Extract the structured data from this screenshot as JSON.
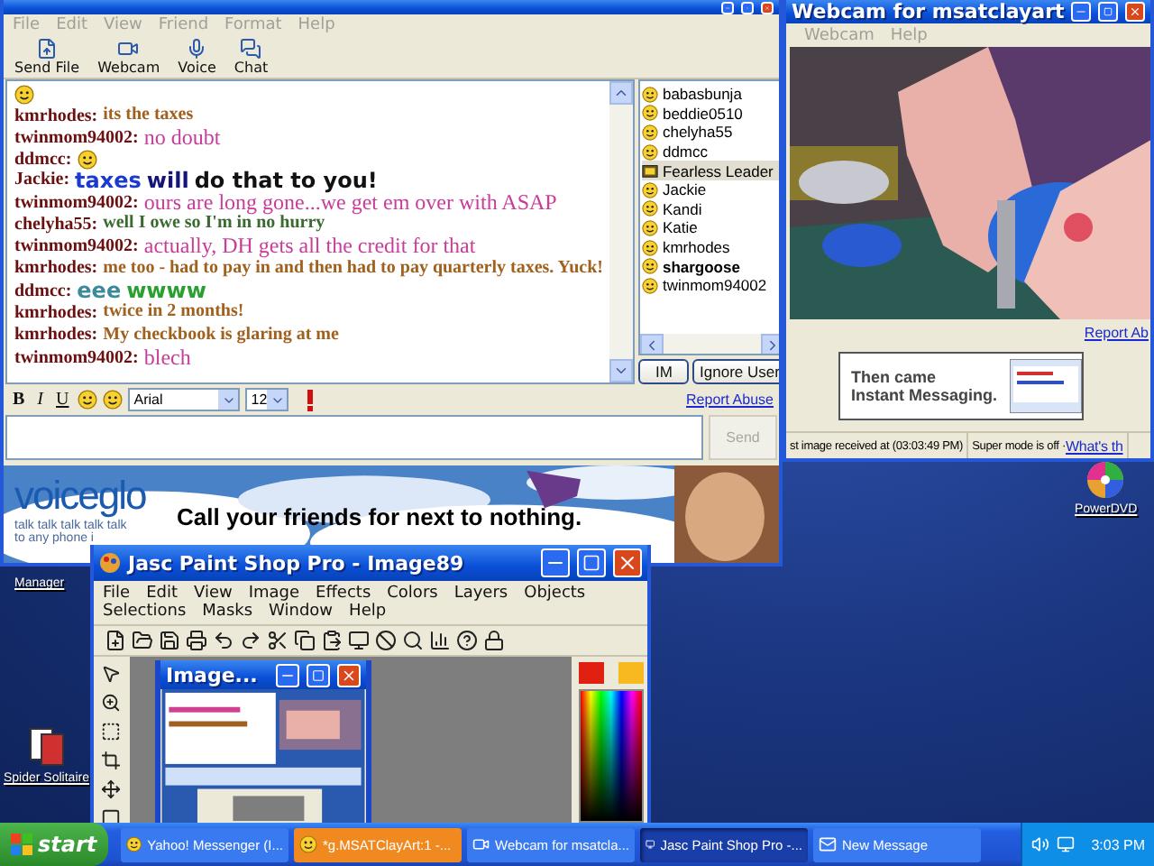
{
  "chat_window": {
    "menu": [
      "File",
      "Edit",
      "View",
      "Friend",
      "Format",
      "Help"
    ],
    "toolbar": [
      {
        "label": "Send File",
        "kind": "send-file"
      },
      {
        "label": "Webcam",
        "kind": "webcam"
      },
      {
        "label": "Voice",
        "kind": "voice"
      },
      {
        "label": "Chat",
        "kind": "chat"
      }
    ],
    "messages": [
      {
        "kind": "emoticon"
      },
      {
        "kind": "bold",
        "sender": "kmrhodes:",
        "parts": [
          {
            "text": "its the taxes",
            "color": "#a0601e"
          }
        ]
      },
      {
        "kind": "serif",
        "sender": "twinmom94002:",
        "parts": [
          {
            "text": "no doubt",
            "color": "#c83c9a"
          }
        ]
      },
      {
        "kind": "emoticon",
        "sender": "ddmcc:"
      },
      {
        "kind": "comic",
        "sender": "Jackie:",
        "parts": [
          {
            "text": "taxes",
            "color": "#1a3ad0"
          },
          {
            "text": "will",
            "color": "#14147a"
          },
          {
            "text": "do that to you!",
            "color": "#111111"
          }
        ]
      },
      {
        "kind": "serif",
        "sender": "twinmom94002:",
        "parts": [
          {
            "text": "ours are long gone...we get em over with ASAP",
            "color": "#c83c9a"
          }
        ]
      },
      {
        "kind": "bold",
        "sender": "chelyha55:",
        "parts": [
          {
            "text": "well I owe so I'm in no hurry",
            "color": "#3a6a30"
          }
        ]
      },
      {
        "kind": "serif",
        "sender": "twinmom94002:",
        "parts": [
          {
            "text": "actually, DH gets all the credit for that",
            "color": "#c83c9a"
          }
        ]
      },
      {
        "kind": "bold",
        "sender": "kmrhodes:",
        "parts": [
          {
            "text": "me too - had to pay in and then had to pay quarterly taxes. Yuck!",
            "color": "#a0601e"
          }
        ]
      },
      {
        "kind": "comic",
        "sender": "ddmcc:",
        "parts": [
          {
            "text": "eee",
            "color": "#3a8a9a"
          },
          {
            "text": "wwww",
            "color": "#2aa030"
          }
        ]
      },
      {
        "kind": "bold",
        "sender": "kmrhodes:",
        "parts": [
          {
            "text": "twice in 2 months!",
            "color": "#a0601e"
          }
        ]
      },
      {
        "kind": "bold",
        "sender": "kmrhodes:",
        "parts": [
          {
            "text": "My checkbook is glaring at me",
            "color": "#a0601e"
          }
        ]
      },
      {
        "kind": "serif",
        "sender": "twinmom94002:",
        "parts": [
          {
            "text": "blech",
            "color": "#c83c9a"
          }
        ]
      }
    ],
    "users": [
      {
        "name": "babasbunja",
        "kind": "smiley",
        "selected": false,
        "bold": false
      },
      {
        "name": "beddie0510",
        "kind": "smiley",
        "selected": false,
        "bold": false
      },
      {
        "name": "chelyha55",
        "kind": "smiley",
        "selected": false,
        "bold": false
      },
      {
        "name": "ddmcc",
        "kind": "smiley",
        "selected": false,
        "bold": false
      },
      {
        "name": "Fearless Leader",
        "kind": "webcam",
        "selected": true,
        "bold": false
      },
      {
        "name": "Jackie",
        "kind": "smiley",
        "selected": false,
        "bold": false
      },
      {
        "name": "Kandi",
        "kind": "smiley",
        "selected": false,
        "bold": false
      },
      {
        "name": "Katie",
        "kind": "smiley",
        "selected": false,
        "bold": false
      },
      {
        "name": "kmrhodes",
        "kind": "smiley",
        "selected": false,
        "bold": false
      },
      {
        "name": "shargoose",
        "kind": "smiley",
        "selected": false,
        "bold": true
      },
      {
        "name": "twinmom94002",
        "kind": "smiley",
        "selected": false,
        "bold": false
      }
    ],
    "user_buttons": [
      "IM",
      "Ignore User"
    ],
    "format_buttons": [
      {
        "label": "B",
        "kind": "bold"
      },
      {
        "label": "I",
        "kind": "italic"
      },
      {
        "label": "U",
        "kind": "underline"
      }
    ],
    "font": "Arial",
    "size": "12",
    "report": "Report Abuse",
    "send": "Send",
    "ad": {
      "logo": "voiceglo",
      "tagline": "talk talk talk talk talk",
      "tagline2": "to any phone i",
      "headline": "Call your friends for next to nothing."
    }
  },
  "webcam_window": {
    "title": "Webcam for msatclayart",
    "menu": [
      "Webcam",
      "Help"
    ],
    "report": "Report Ab",
    "ad": [
      "Then came",
      "Instant Messaging."
    ],
    "status": "st image received at (03:03:49 PM)",
    "super": "Super mode is off · ",
    "link": "What's th"
  },
  "paint_window": {
    "title": "Jasc Paint Shop Pro - Image89",
    "menu": [
      "File",
      "Edit",
      "View",
      "Image",
      "Effects",
      "Colors",
      "Layers",
      "Objects",
      "Selections",
      "Masks",
      "Window",
      "Help"
    ],
    "inner_title": "Image...",
    "swatches": [
      {
        "color": "#e02010"
      },
      {
        "color": "#f8b820"
      }
    ]
  },
  "desktop_icons": [
    {
      "label": "Manager",
      "kind": "manager"
    },
    {
      "label": "Spider Solitaire",
      "kind": "cards"
    },
    {
      "label": "PowerDVD",
      "kind": "disc"
    }
  ],
  "taskbar": {
    "start": "start",
    "tasks": [
      {
        "label": "Yahoo! Messenger (I...",
        "kind": "messenger",
        "selected": false,
        "flashing": false
      },
      {
        "label": "*g.MSATClayArt:1 -...",
        "kind": "chat",
        "selected": false,
        "flashing": true
      },
      {
        "label": "Webcam for msatcla...",
        "kind": "webcam",
        "selected": false,
        "flashing": false
      },
      {
        "label": "Jasc Paint Shop Pro -...",
        "kind": "paint",
        "selected": true,
        "flashing": false
      },
      {
        "label": "New Message",
        "kind": "mail",
        "selected": false,
        "flashing": false
      }
    ],
    "clock": "3:03 PM"
  }
}
